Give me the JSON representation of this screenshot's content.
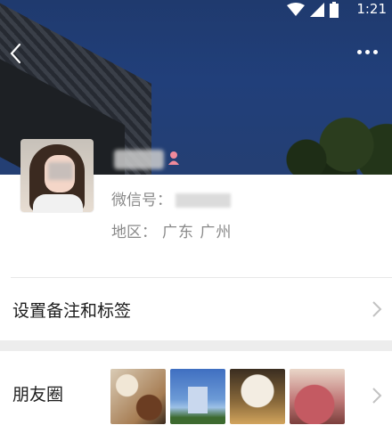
{
  "status_bar": {
    "time": "1:21",
    "icons": [
      "wifi-icon",
      "cellular-signal-icon",
      "battery-icon"
    ]
  },
  "nav": {
    "back_icon": "back-chevron-icon",
    "more_icon": "more-dots-icon"
  },
  "profile": {
    "gender_icon": "female-icon",
    "wechat_id_label": "微信号：",
    "region_label": "地区：",
    "region_value": "广东 广州"
  },
  "menu": {
    "remark_label": "设置备注和标签",
    "moments_label": "朋友圈"
  },
  "watermark": "IIIIII",
  "colors": {
    "accent_female": "#f08a9b",
    "label_text": "#1b1b1b",
    "secondary_text": "#8a8a8a",
    "separator": "#ededed"
  }
}
